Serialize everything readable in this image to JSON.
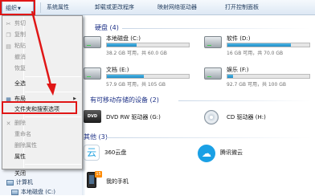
{
  "toolbar": {
    "organize": "组织",
    "system_properties": "系统属性",
    "uninstall": "卸载或更改程序",
    "map_drive": "映射网络驱动器",
    "control_panel": "打开控制面板"
  },
  "menu": {
    "items": [
      {
        "label": "剪切",
        "icon": "scissors-icon",
        "enabled": false
      },
      {
        "label": "复制",
        "icon": "copy-icon",
        "enabled": false
      },
      {
        "label": "粘贴",
        "icon": "paste-icon",
        "enabled": false
      },
      {
        "label": "撤消",
        "enabled": false
      },
      {
        "label": "恢复",
        "enabled": false
      },
      {
        "label": "全选",
        "enabled": true
      },
      {
        "label": "布局",
        "enabled": true,
        "submenu": true
      },
      {
        "label": "文件夹和搜索选项",
        "enabled": true,
        "highlighted": true
      },
      {
        "label": "删除",
        "icon": "delete-icon",
        "enabled": false
      },
      {
        "label": "重命名",
        "enabled": false
      },
      {
        "label": "删除属性",
        "enabled": false
      },
      {
        "label": "属性",
        "enabled": true
      },
      {
        "label": "关闭",
        "enabled": true
      }
    ]
  },
  "sections": {
    "hard_drives": "硬盘 (4)",
    "removable": "有可移动存储的设备 (2)",
    "other": "其他 (3)"
  },
  "drives": [
    {
      "name": "本地磁盘 (C:)",
      "free": "38.2 GB 可用，共 60.0 GB",
      "used_fraction": 0.36
    },
    {
      "name": "软件 (D:)",
      "free": "16 GB 可用，共 70.0 GB",
      "used_fraction": 0.77
    },
    {
      "name": "文档 (E:)",
      "free": "57.9 GB 可用，共 105 GB",
      "used_fraction": 0.45
    },
    {
      "name": "娱乐 (F:)",
      "free": "92.7 GB 可用，共 100 GB",
      "used_fraction": 0.07
    }
  ],
  "devices": [
    {
      "name": "DVD RW 驱动器 (G:)",
      "icon_text": "DVD"
    },
    {
      "name": "CD 驱动器 (H:)"
    }
  ],
  "other_items": [
    {
      "name": "360云盘",
      "icon_text": "云"
    },
    {
      "name": "腾讯微云",
      "icon_text": "☁"
    },
    {
      "name": "我的手机",
      "badge": "15"
    }
  ],
  "tree": {
    "computer": "计算机",
    "local_disk": "本地磁盘 (C:)"
  },
  "colors": {
    "highlight": "#e01616",
    "bar_fill": "#1f8cc6"
  }
}
